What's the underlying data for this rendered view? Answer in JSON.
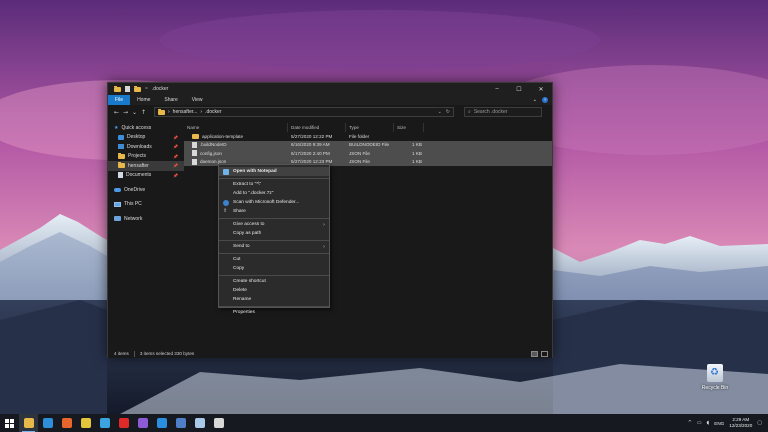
{
  "window": {
    "title": ".docker",
    "controls": {
      "minimize": "–",
      "maximize": "☐",
      "close": "✕"
    }
  },
  "ribbon": {
    "tabs": [
      {
        "label": "File"
      },
      {
        "label": "Home"
      },
      {
        "label": "Share"
      },
      {
        "label": "View"
      }
    ],
    "expand": "⌄",
    "help": "?"
  },
  "addressbar": {
    "back": "←",
    "forward": "→",
    "recent": "⌄",
    "up": "↑",
    "path": [
      "hensafter...",
      ".docker"
    ],
    "path_sep": "›",
    "refresh": "↻",
    "dropdown": "⌄",
    "search_placeholder": "Search .docker"
  },
  "navpane": {
    "quick_access": "Quick access",
    "items": [
      {
        "label": "Desktop",
        "pinned": true
      },
      {
        "label": "Downloads",
        "pinned": true
      },
      {
        "label": "Projects",
        "pinned": true
      },
      {
        "label": "hensafter",
        "pinned": true,
        "selected": true
      },
      {
        "label": "Documents",
        "pinned": true
      }
    ],
    "onedrive": "OneDrive",
    "thispc": "This PC",
    "network": "Network",
    "pin_glyph": "📌"
  },
  "filelist": {
    "columns": [
      "Name",
      "Date modified",
      "Type",
      "Size"
    ],
    "sort_arrow": "^",
    "rows": [
      {
        "name": "application-template",
        "date": "5/27/2020 12:22 PM",
        "type": "File folder",
        "size": "",
        "selected": false,
        "kind": "folder"
      },
      {
        "name": ".buildNodeID",
        "date": "6/16/2020 9:39 AM",
        "type": "BUILDNODEID File",
        "size": "1 KB",
        "selected": true,
        "kind": "file"
      },
      {
        "name": "config.json",
        "date": "6/17/2020 2:40 PM",
        "type": "JSON File",
        "size": "1 KB",
        "selected": true,
        "kind": "json"
      },
      {
        "name": "daemon.json",
        "date": "5/27/2020 12:23 PM",
        "type": "JSON File",
        "size": "1 KB",
        "selected": true,
        "kind": "json"
      }
    ]
  },
  "status": {
    "count": "4 items",
    "selected": "3 items selected  330 bytes"
  },
  "context_menu": {
    "items": [
      {
        "label": "Open with Notepad",
        "bold": true,
        "icon": "notepad-icon"
      },
      {
        "sep": true
      },
      {
        "label": "Extract to \"*\\\""
      },
      {
        "label": "Add to \".docker.7z\""
      },
      {
        "label": "Scan with Microsoft Defender...",
        "icon": "defender-icon"
      },
      {
        "label": "Share",
        "icon": "share-icon"
      },
      {
        "sep": true
      },
      {
        "label": "Give access to",
        "submenu": true
      },
      {
        "label": "Copy as path"
      },
      {
        "sep": true
      },
      {
        "label": "Send to",
        "submenu": true
      },
      {
        "sep": true
      },
      {
        "label": "Cut"
      },
      {
        "label": "Copy"
      },
      {
        "sep": true
      },
      {
        "label": "Create shortcut"
      },
      {
        "label": "Delete"
      },
      {
        "label": "Rename"
      },
      {
        "sep": true
      },
      {
        "label": "Properties"
      }
    ],
    "submenu_arrow": "›"
  },
  "desktop": {
    "recycle_bin": "Recycle Bin"
  },
  "taskbar": {
    "apps": [
      {
        "name": "file-explorer-icon",
        "color": "#e8b84a",
        "active": true
      },
      {
        "name": "edge-icon",
        "color": "#2f8ed8"
      },
      {
        "name": "firefox-icon",
        "color": "#e8662c"
      },
      {
        "name": "chrome-icon",
        "color": "#e5c53a"
      },
      {
        "name": "telegram-icon",
        "color": "#3aa3e0"
      },
      {
        "name": "youtube-icon",
        "color": "#e02a2a"
      },
      {
        "name": "visual-studio-icon",
        "color": "#8c5bd6"
      },
      {
        "name": "vscode-icon",
        "color": "#2b8fe0"
      },
      {
        "name": "virtualbox-icon",
        "color": "#4f7fc8"
      },
      {
        "name": "snip-icon",
        "color": "#a9c9e8"
      },
      {
        "name": "settings-icon",
        "color": "#d8d8d8"
      }
    ],
    "tray": {
      "chevron": "^",
      "lang": "ENG",
      "time": "2:29 AM",
      "date": "12/23/2020"
    }
  }
}
